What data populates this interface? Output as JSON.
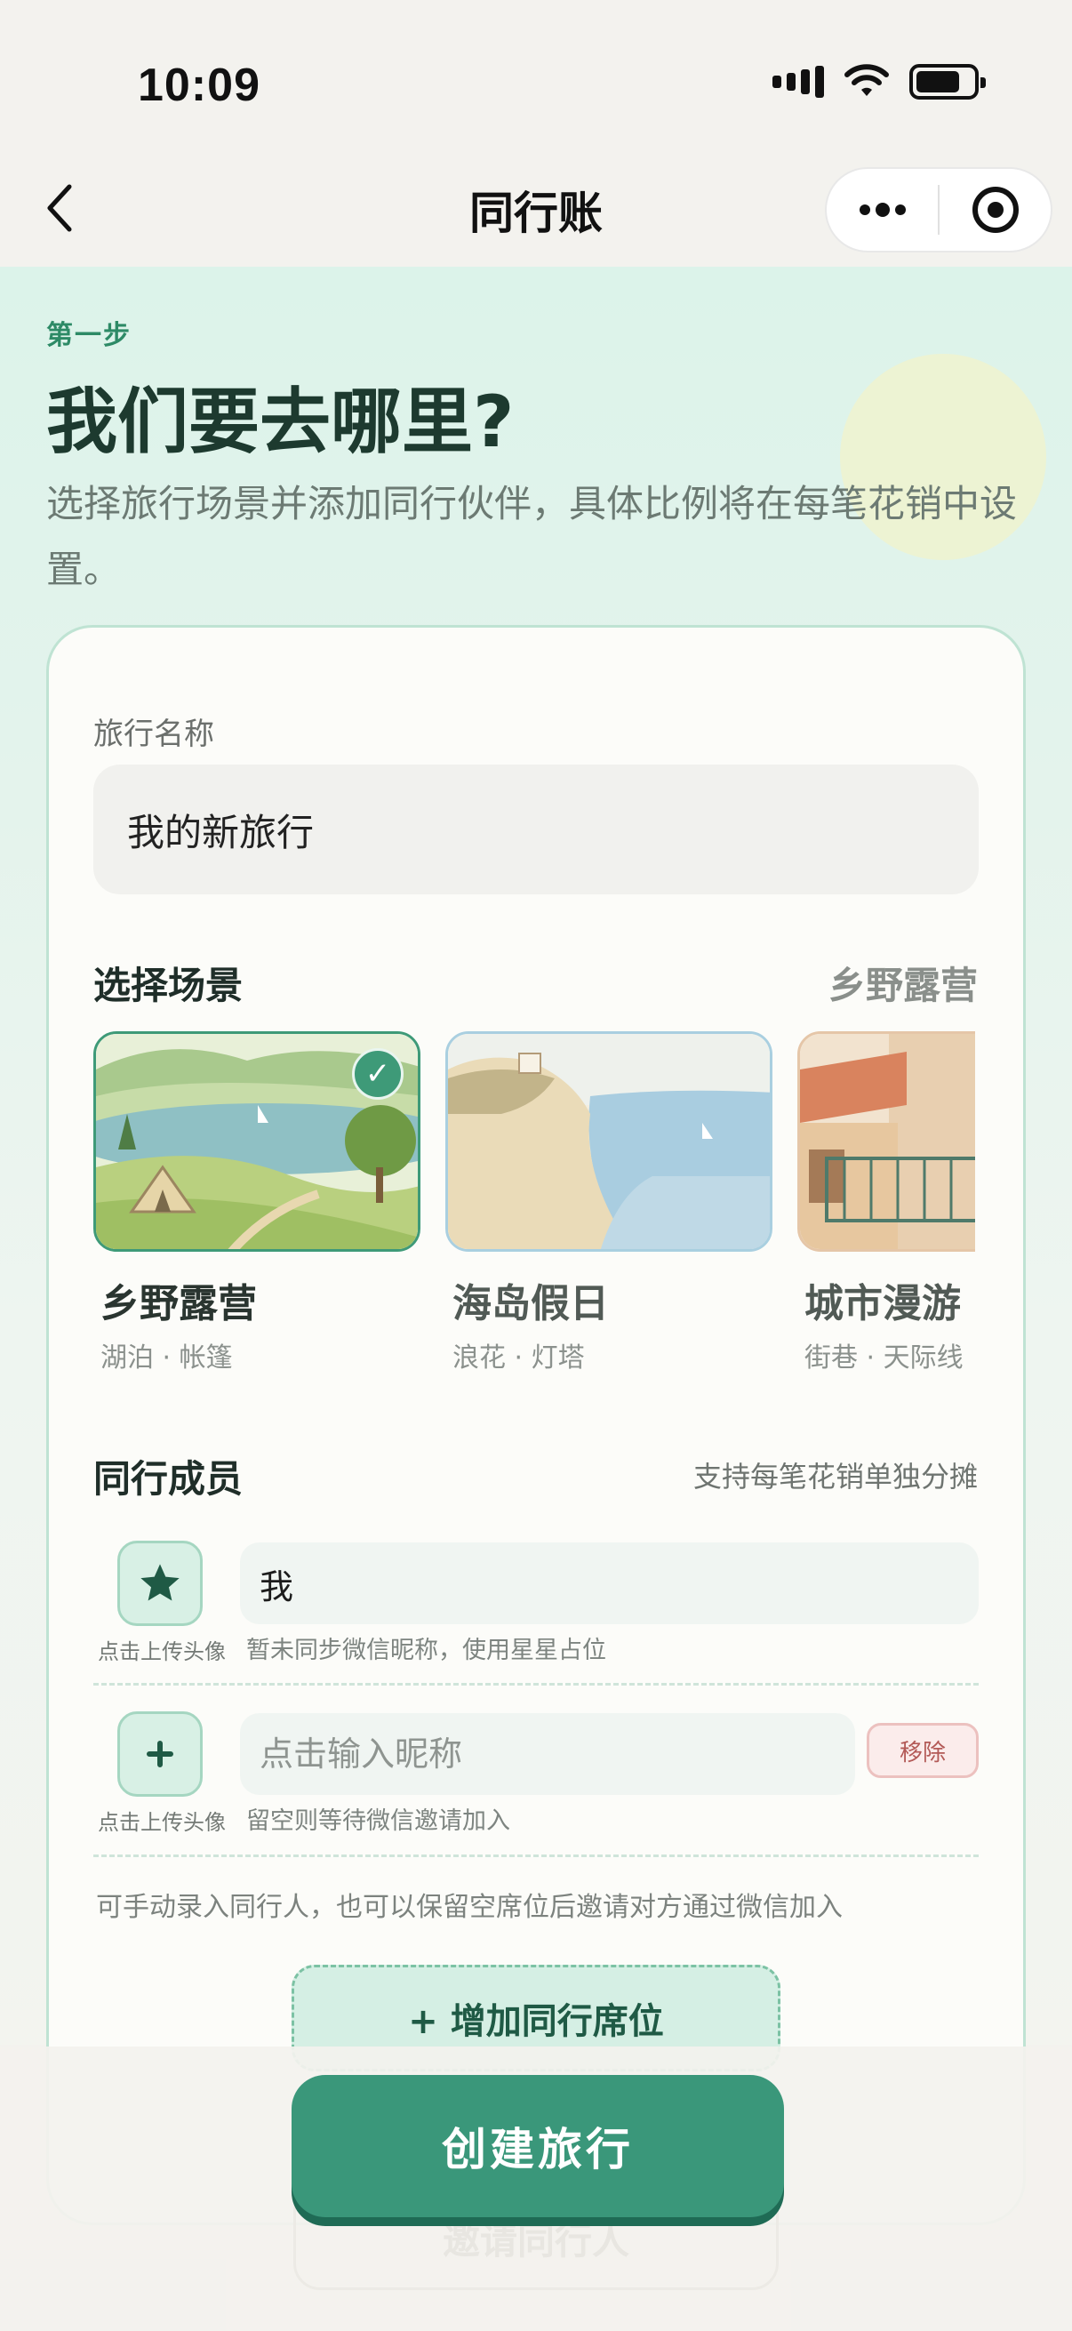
{
  "status_bar": {
    "time": "10:09"
  },
  "nav": {
    "title": "同行账"
  },
  "header": {
    "step": "第一步",
    "title": "我们要去哪里?",
    "subtitle": "选择旅行场景并添加同行伙伴，具体比例将在每笔花销中设置。"
  },
  "form": {
    "trip_name_label": "旅行名称",
    "trip_name_value": "我的新旅行"
  },
  "scenes": {
    "title": "选择场景",
    "selected": "乡野露营",
    "items": [
      {
        "name": "乡野露营",
        "tags": "湖泊 · 帐篷",
        "selected": true
      },
      {
        "name": "海岛假日",
        "tags": "浪花 · 灯塔",
        "selected": false
      },
      {
        "name": "城市漫游",
        "tags": "街巷 · 天际线",
        "selected": false
      }
    ]
  },
  "members": {
    "title": "同行成员",
    "note": "支持每笔花销单独分摊",
    "upload_caption": "点击上传头像",
    "list": [
      {
        "icon": "star-icon",
        "value": "我",
        "placeholder": "",
        "hint": "暂未同步微信昵称，使用星星占位"
      },
      {
        "icon": "plus-icon",
        "value": "",
        "placeholder": "点击输入昵称",
        "hint": "留空则等待微信邀请加入",
        "remove_label": "移除"
      }
    ],
    "footer_note": "可手动录入同行人，也可以保留空席位后邀请对方通过微信加入",
    "add_seat_label": "+ 增加同行席位"
  },
  "bottom": {
    "create_label": "创建旅行",
    "invite_label": "邀请同行人"
  },
  "colors": {
    "primary": "#3a977a",
    "accent_text": "#2d8a66",
    "card_border": "#bfe3d3"
  }
}
